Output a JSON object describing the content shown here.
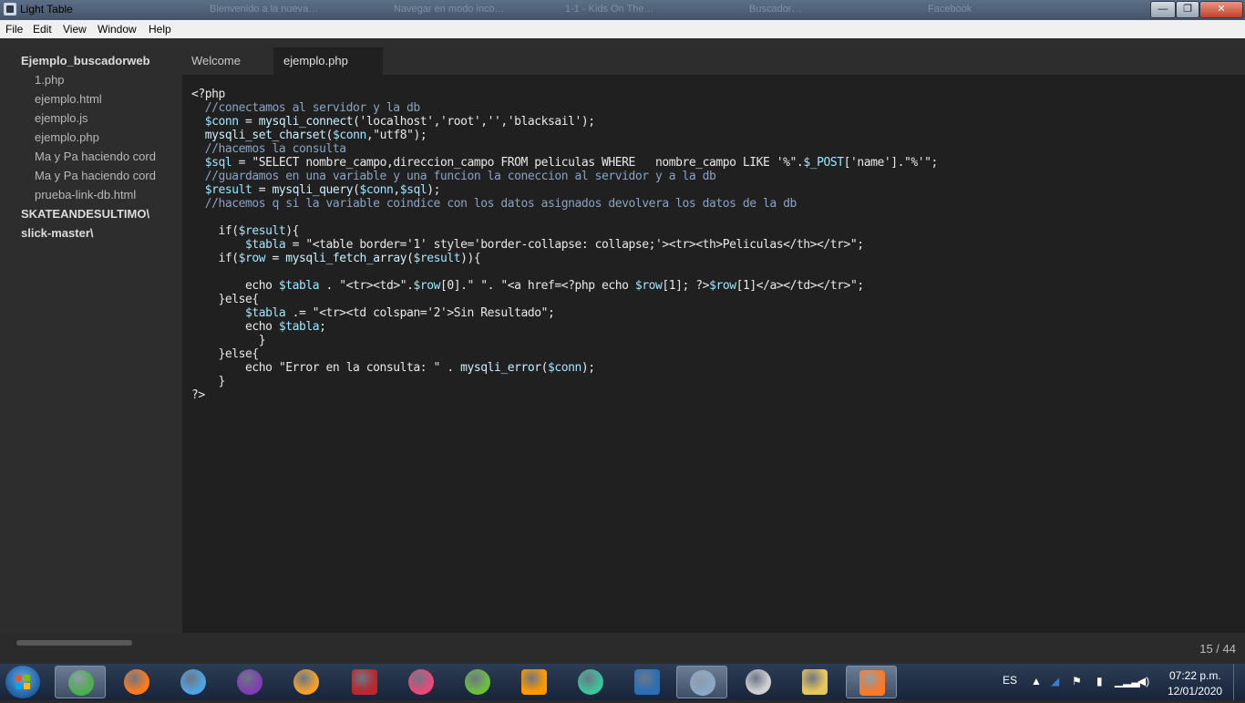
{
  "window": {
    "title": "Light Table",
    "minimize": "—",
    "maximize": "❐",
    "close": "✕"
  },
  "background_tabs": [
    "Bienvenido a la nueva…",
    "Navegar en modo inco…",
    "1-1 - Kids On The…",
    "Buscador…",
    "Facebook"
  ],
  "menu": [
    "File",
    "Edit",
    "View",
    "Window",
    "Help"
  ],
  "sidebar": {
    "items": [
      {
        "label": "Ejemplo_buscadorweb",
        "type": "folder"
      },
      {
        "label": "1.php",
        "type": "file"
      },
      {
        "label": "ejemplo.html",
        "type": "file"
      },
      {
        "label": "ejemplo.js",
        "type": "file"
      },
      {
        "label": "ejemplo.php",
        "type": "file"
      },
      {
        "label": "Ma y Pa haciendo cord",
        "type": "file"
      },
      {
        "label": "Ma y Pa haciendo cord",
        "type": "file"
      },
      {
        "label": "prueba-link-db.html",
        "type": "file"
      },
      {
        "label": "SKATEANDESULTIMO\\",
        "type": "folder"
      },
      {
        "label": "slick-master\\",
        "type": "folder"
      }
    ]
  },
  "tabs": [
    {
      "label": "Welcome",
      "active": false
    },
    {
      "label": "ejemplo.php",
      "active": true
    }
  ],
  "editor": {
    "lines": [
      "<?php",
      "  //conectamos al servidor y la db",
      "  $conn = mysqli_connect('localhost','root','','blacksail');",
      "  mysqli_set_charset($conn,\"utf8\");",
      "  //hacemos la consulta",
      "  $sql = \"SELECT nombre_campo,direccion_campo FROM peliculas WHERE   nombre_campo LIKE '%\".$_POST['name'].\"%'\";",
      "  //guardamos en una variable y una funcion la coneccion al servidor y a la db",
      "  $result = mysqli_query($conn,$sql);",
      "  //hacemos q si la variable coindice con los datos asignados devolvera los datos de la db",
      "",
      "    if($result){",
      "        $tabla = \"<table border='1' style='border-collapse: collapse;'><tr><th>Peliculas</th></tr>\";",
      "    if($row = mysqli_fetch_array($result)){",
      "",
      "        echo $tabla . \"<tr><td>\".$row[0].\" \". \"<a href=<?php echo $row[1]; ?>$row[1]</a></td></tr>\";",
      "    }else{",
      "        $tabla .= \"<tr><td colspan='2'>Sin Resultado\";",
      "        echo $tabla;",
      "          }",
      "    }else{",
      "        echo \"Error en la consulta: \" . mysqli_error($conn);",
      "    }",
      "?>"
    ]
  },
  "status": {
    "line_count": "15 / 44"
  },
  "taskbar": {
    "apps": [
      {
        "icon": "chrome-icon",
        "color": "#4caf50",
        "open": true
      },
      {
        "icon": "firefox-icon",
        "color": "#ff7a1a",
        "open": false
      },
      {
        "icon": "safari-icon",
        "color": "#4fa3e0",
        "open": false
      },
      {
        "icon": "tor-icon",
        "color": "#7e3fb0",
        "open": false
      },
      {
        "icon": "fl-studio-icon",
        "color": "#f2a12e",
        "open": false
      },
      {
        "icon": "winrar-icon",
        "color": "#b8282d",
        "open": false
      },
      {
        "icon": "itunes-icon",
        "color": "#e84a7a",
        "open": false
      },
      {
        "icon": "utorrent-icon",
        "color": "#6cbf3f",
        "open": false
      },
      {
        "icon": "sublime-icon",
        "color": "#ff9800",
        "open": false
      },
      {
        "icon": "atom-icon",
        "color": "#3cc39a",
        "open": false
      },
      {
        "icon": "bracket-icon",
        "color": "#2a6fb5",
        "open": false
      },
      {
        "icon": "lighttable-icon",
        "color": "#8ba9c7",
        "open": true
      },
      {
        "icon": "steering-icon",
        "color": "#d0d0d0",
        "open": false
      },
      {
        "icon": "explorer-icon",
        "color": "#e8c55c",
        "open": false
      },
      {
        "icon": "xampp-icon",
        "color": "#fb7a24",
        "open": true
      }
    ],
    "lang": "ES",
    "time": "07:22 p.m.",
    "date": "12/01/2020"
  }
}
